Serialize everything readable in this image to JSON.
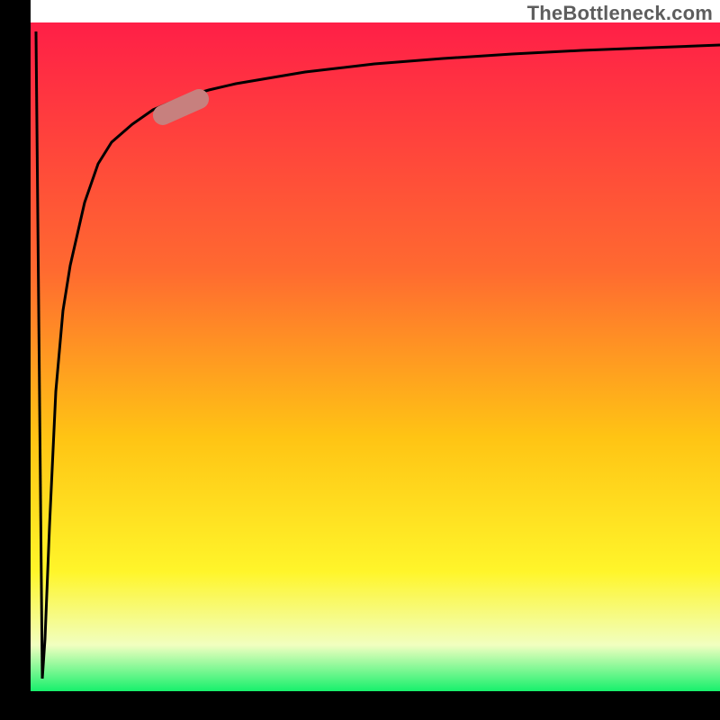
{
  "brand": "TheBottleneck.com",
  "colors": {
    "frame": "#000000",
    "curve": "#000000",
    "marker": "#c7807e",
    "grad_top": "#ff1f47",
    "grad_mid1": "#ff6a30",
    "grad_mid2": "#ffc414",
    "grad_mid3": "#fff52a",
    "grad_light": "#f1ffc0",
    "grad_bottom": "#13f06a"
  },
  "chart_data": {
    "type": "line",
    "title": "",
    "xlabel": "",
    "ylabel": "",
    "xlim": [
      0,
      100
    ],
    "ylim": [
      0,
      100
    ],
    "annotations": [],
    "series": [
      {
        "name": "curve",
        "x": [
          2,
          2.4,
          3,
          4,
          5,
          6,
          8,
          10,
          12,
          15,
          18,
          22,
          26,
          30,
          40,
          50,
          60,
          70,
          80,
          90,
          100
        ],
        "y": [
          2,
          8,
          25,
          45,
          57,
          64,
          73,
          79,
          82,
          85,
          87,
          89,
          90,
          91,
          93,
          94.2,
          95,
          95.6,
          96.2,
          96.7,
          97
        ]
      }
    ],
    "marker": {
      "x_center": 22,
      "y_center": 85,
      "along_curve_deg": 35
    },
    "gradient_bands_topdown": [
      {
        "at": 0.0,
        "name": "red"
      },
      {
        "at": 0.4,
        "name": "orange"
      },
      {
        "at": 0.7,
        "name": "yellow"
      },
      {
        "at": 0.85,
        "name": "pale-yellow"
      },
      {
        "at": 0.95,
        "name": "light-green"
      },
      {
        "at": 1.0,
        "name": "green"
      }
    ]
  }
}
